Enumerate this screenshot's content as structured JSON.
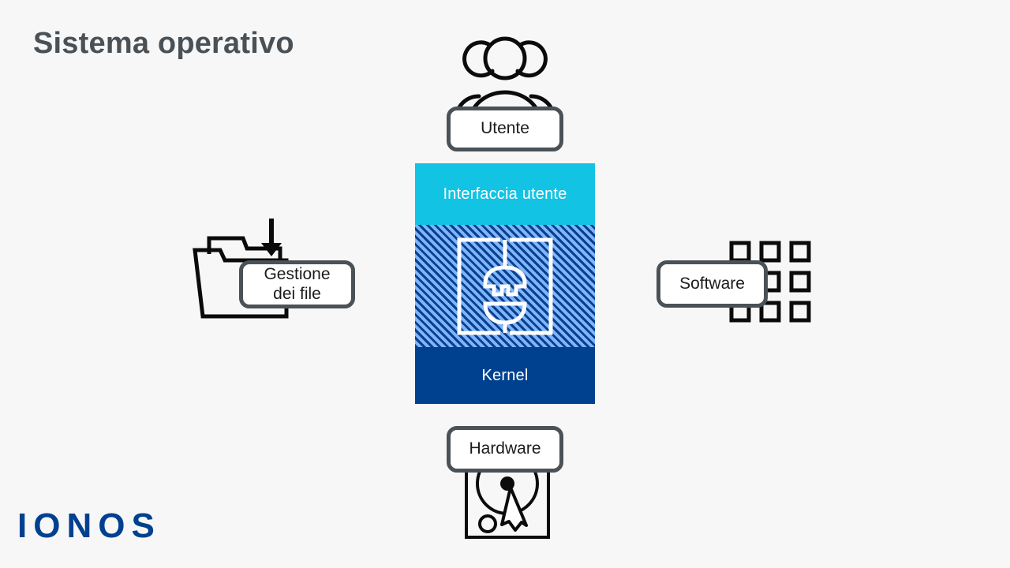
{
  "slide": {
    "title": "Sistema operativo",
    "background_color": "#f7f7f7",
    "title_color": "#4a5156"
  },
  "logo": {
    "text": "IONOS",
    "color": "#00418f"
  },
  "os_stack": {
    "layers": [
      {
        "id": "user-interface",
        "label": "Interfaccia utente",
        "color": "#13c3e3",
        "text_color": "#ffffff"
      },
      {
        "id": "core",
        "label": "",
        "color": "#7eb5fb",
        "stripe_color": "#0a3f8f",
        "icon": "plug-socket-icon"
      },
      {
        "id": "kernel",
        "label": "Kernel",
        "color": "#00418f",
        "text_color": "#ffffff"
      }
    ]
  },
  "nodes": {
    "user": {
      "label": "Utente",
      "icon": "users-group-icon"
    },
    "hardware": {
      "label": "Hardware",
      "icon": "hard-disk-icon"
    },
    "file_management": {
      "label": "Gestione\ndei file",
      "line1": "Gestione",
      "line2": "dei file",
      "icon": "folder-download-icon"
    },
    "software": {
      "label": "Software",
      "icon": "app-grid-icon"
    }
  },
  "style": {
    "pill_border_color": "#4a5258",
    "pill_fill_color": "#ffffff",
    "icon_stroke_color": "#000000"
  }
}
